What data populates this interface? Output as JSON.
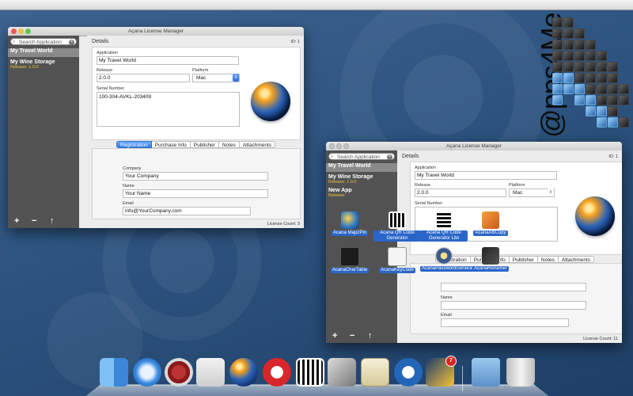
{
  "window1": {
    "title": "Açana License Manager",
    "search_placeholder": "Search Application",
    "sidebar_items": [
      {
        "name": "My Travel World",
        "release": ""
      },
      {
        "name": "My Wine Storage",
        "release": "Release: 1.0.0"
      }
    ],
    "details_header": "Details",
    "id_label": "ID: 1",
    "application_label": "Application",
    "application_value": "My Travel World",
    "release_label": "Release",
    "release_value": "2.0.0",
    "platform_label": "Platform",
    "platform_value": "Mac",
    "serial_label": "Serial Number",
    "serial_value": "100-304-AVKL-203409",
    "tabs": [
      "Registration",
      "Purchase Info",
      "Publisher",
      "Notes",
      "Attachments"
    ],
    "company_label": "Company",
    "company_value": "Your Company",
    "name_label": "Name",
    "name_value": "Your Name",
    "email_label": "Email",
    "email_value": "info@YourCompany.com",
    "license_count": "License Count: 3",
    "sidebar_buttons": [
      "+",
      "−",
      "↑"
    ]
  },
  "window2": {
    "title": "Açana License Manager",
    "search_placeholder": "Search Application",
    "sidebar_items": [
      {
        "name": "My Travel World",
        "release": ""
      },
      {
        "name": "My Wine Storage",
        "release": "Release: 1.0.0"
      },
      {
        "name": "New App",
        "release": "Release:"
      }
    ],
    "details_header": "Details",
    "id_label": "ID: 1",
    "application_label": "Application",
    "application_value": "My Travel World",
    "release_label": "Release",
    "release_value": "2.0.0",
    "platform_label": "Platform",
    "platform_value": "Mac",
    "serial_label": "Serial Number",
    "tabs": [
      "Registration",
      "Purchase Info",
      "Publisher",
      "Notes",
      "Attachments"
    ],
    "name_label": "Name",
    "email_label": "Email",
    "license_count": "License Count: 11",
    "sidebar_buttons": [
      "+",
      "−",
      "↑"
    ]
  },
  "desktop_icons": [
    {
      "label": "Acana Map2Pin",
      "icon": "map2pin-icon"
    },
    {
      "label": "Acana QR Code Generator",
      "icon": "qr-code-icon"
    },
    {
      "label": "Acana QR Code Generator Lite",
      "icon": "qr-code-lite-icon"
    },
    {
      "label": "AcanaABCopy",
      "icon": "abcopy-icon"
    },
    {
      "label": "AcanaCharTable",
      "icon": "chartable-icon"
    },
    {
      "label": "AcanaKeyCode",
      "icon": "keycode-icon"
    },
    {
      "label": "AcanaPasswordGenerator",
      "icon": "password-generator-icon"
    },
    {
      "label": "AcanaRenamer",
      "icon": "renamer-icon"
    }
  ],
  "logo_text": "@pps4Me",
  "dock": {
    "items": [
      "finder-icon",
      "safari-icon",
      "garantie-icon",
      "car-app-icon",
      "globe-app-icon",
      "acana-a-icon",
      "qr-lite-icon",
      "usb-icon",
      "calendar-icon",
      "handshake-icon",
      "star-app-icon",
      "folder-icon",
      "trash-icon"
    ],
    "badge": "7"
  },
  "colors": {
    "accent": "#2f78e2",
    "sidebar": "#525252",
    "release_text": "#e8c640"
  }
}
